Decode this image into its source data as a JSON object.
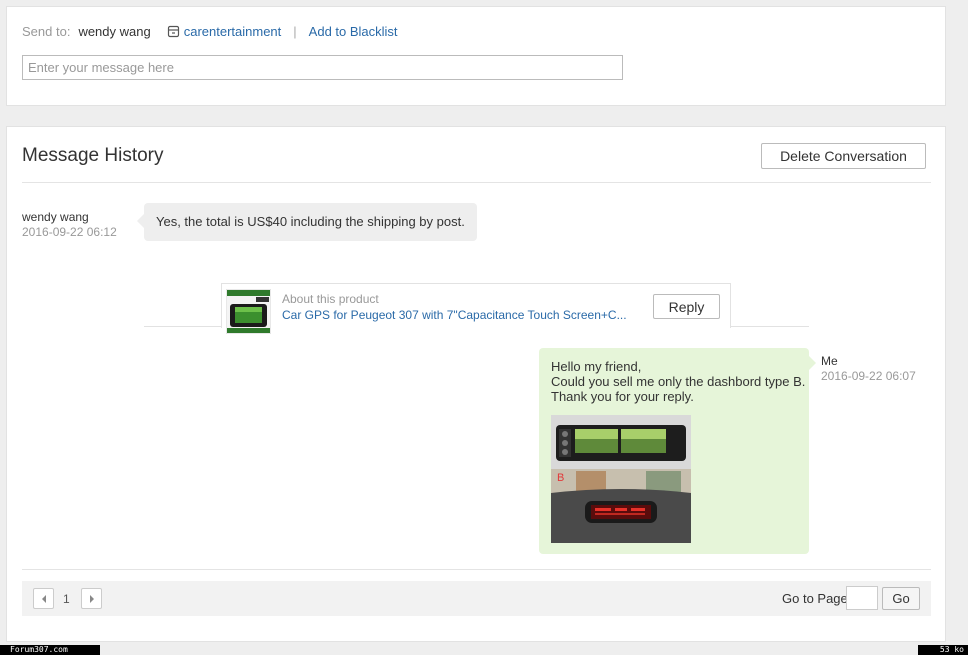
{
  "send": {
    "label": "Send to:",
    "recipient": "wendy wang",
    "store_name": "carentertainment",
    "separator": "|",
    "blacklist_label": "Add to Blacklist",
    "input_placeholder": "Enter your message here"
  },
  "history": {
    "title": "Message History",
    "delete_label": "Delete Conversation",
    "messages": [
      {
        "sender": "wendy wang",
        "time": "2016-09-22 06:12",
        "text": "Yes, the total is US$40 including the shipping by post."
      },
      {
        "sender": "Me",
        "time": "2016-09-22 06:07",
        "lines": [
          "Hello my friend,",
          "Could you sell me only the dashbord type B.",
          "Thank you for your reply."
        ]
      }
    ],
    "product": {
      "about_label": "About this product",
      "name": "Car GPS for Peugeot 307 with 7\"Capacitance Touch Screen+C...",
      "reply_label": "Reply"
    }
  },
  "pagination": {
    "current_page": "1",
    "goto_label": "Go to Page",
    "go_label": "Go"
  },
  "footer": {
    "watermark_left": "Forum307.com",
    "watermark_right": "53 ko"
  },
  "colors": {
    "link": "#2a6aa8",
    "my_bubble": "#e6f5d9",
    "their_bubble": "#eeeeee"
  }
}
